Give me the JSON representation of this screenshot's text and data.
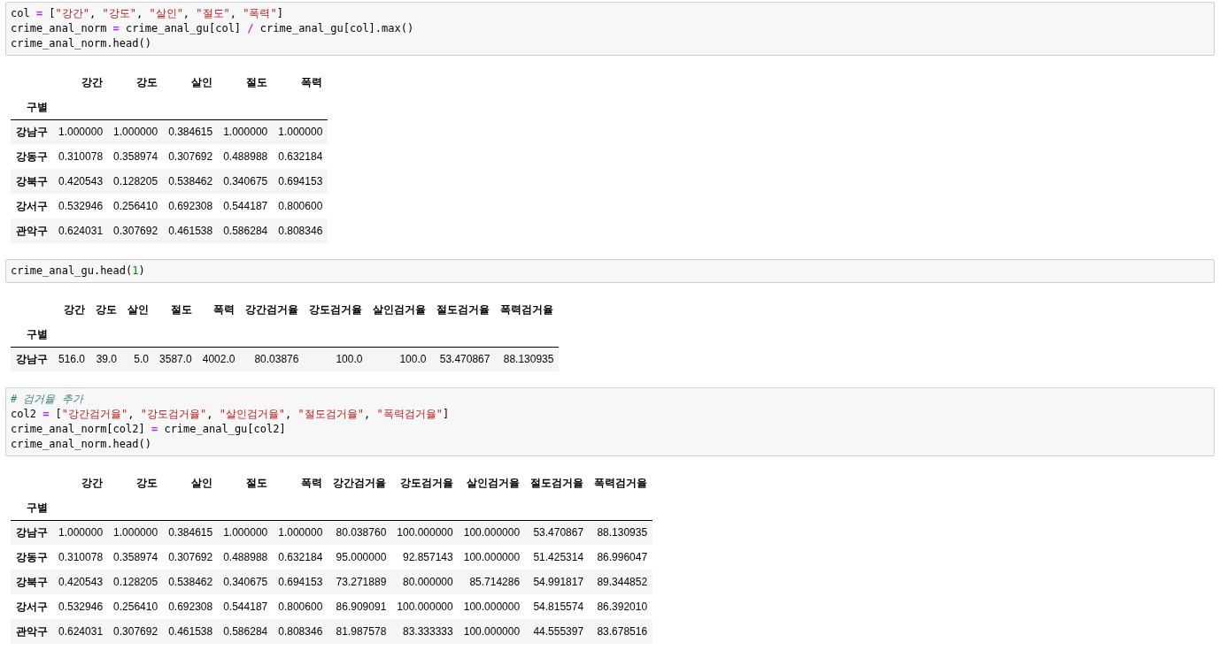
{
  "cells": [
    {
      "kind": "code",
      "lines": [
        [
          {
            "t": "col ",
            "kind": "plain"
          },
          {
            "t": "=",
            "kind": "op"
          },
          {
            "t": " [",
            "kind": "plain"
          },
          {
            "t": "\"강간\"",
            "kind": "string"
          },
          {
            "t": ", ",
            "kind": "plain"
          },
          {
            "t": "\"강도\"",
            "kind": "string"
          },
          {
            "t": ", ",
            "kind": "plain"
          },
          {
            "t": "\"살인\"",
            "kind": "string"
          },
          {
            "t": ", ",
            "kind": "plain"
          },
          {
            "t": "\"절도\"",
            "kind": "string"
          },
          {
            "t": ", ",
            "kind": "plain"
          },
          {
            "t": "\"폭력\"",
            "kind": "string"
          },
          {
            "t": "]",
            "kind": "plain"
          }
        ],
        [
          {
            "t": "crime_anal_norm ",
            "kind": "plain"
          },
          {
            "t": "=",
            "kind": "op"
          },
          {
            "t": " crime_anal_gu[col] ",
            "kind": "plain"
          },
          {
            "t": "/",
            "kind": "op"
          },
          {
            "t": " crime_anal_gu[col].max()",
            "kind": "plain"
          }
        ],
        [
          {
            "t": "crime_anal_norm.head()",
            "kind": "plain"
          }
        ]
      ]
    },
    {
      "kind": "table",
      "index_name": "구별",
      "columns": [
        "강간",
        "강도",
        "살인",
        "절도",
        "폭력"
      ],
      "rows": [
        {
          "index": "강남구",
          "values": [
            "1.000000",
            "1.000000",
            "0.384615",
            "1.000000",
            "1.000000"
          ]
        },
        {
          "index": "강동구",
          "values": [
            "0.310078",
            "0.358974",
            "0.307692",
            "0.488988",
            "0.632184"
          ]
        },
        {
          "index": "강북구",
          "values": [
            "0.420543",
            "0.128205",
            "0.538462",
            "0.340675",
            "0.694153"
          ]
        },
        {
          "index": "강서구",
          "values": [
            "0.532946",
            "0.256410",
            "0.692308",
            "0.544187",
            "0.800600"
          ]
        },
        {
          "index": "관악구",
          "values": [
            "0.624031",
            "0.307692",
            "0.461538",
            "0.586284",
            "0.808346"
          ]
        }
      ]
    },
    {
      "kind": "code",
      "lines": [
        [
          {
            "t": "crime_anal_gu.head(",
            "kind": "plain"
          },
          {
            "t": "1",
            "kind": "number"
          },
          {
            "t": ")",
            "kind": "plain"
          }
        ]
      ]
    },
    {
      "kind": "table",
      "index_name": "구별",
      "columns": [
        "강간",
        "강도",
        "살인",
        "절도",
        "폭력",
        "강간검거율",
        "강도검거율",
        "살인검거율",
        "절도검거율",
        "폭력검거율"
      ],
      "rows": [
        {
          "index": "강남구",
          "values": [
            "516.0",
            "39.0",
            "5.0",
            "3587.0",
            "4002.0",
            "80.03876",
            "100.0",
            "100.0",
            "53.470867",
            "88.130935"
          ]
        }
      ]
    },
    {
      "kind": "code",
      "lines": [
        [
          {
            "t": "# 검거율 추가",
            "kind": "comment"
          }
        ],
        [
          {
            "t": "col2 ",
            "kind": "plain"
          },
          {
            "t": "=",
            "kind": "op"
          },
          {
            "t": " [",
            "kind": "plain"
          },
          {
            "t": "\"강간검거율\"",
            "kind": "string"
          },
          {
            "t": ", ",
            "kind": "plain"
          },
          {
            "t": "\"강도검거율\"",
            "kind": "string"
          },
          {
            "t": ", ",
            "kind": "plain"
          },
          {
            "t": "\"살인검거율\"",
            "kind": "string"
          },
          {
            "t": ", ",
            "kind": "plain"
          },
          {
            "t": "\"절도검거율\"",
            "kind": "string"
          },
          {
            "t": ", ",
            "kind": "plain"
          },
          {
            "t": "\"폭력검거율\"",
            "kind": "string"
          },
          {
            "t": "]",
            "kind": "plain"
          }
        ],
        [
          {
            "t": "crime_anal_norm[col2] ",
            "kind": "plain"
          },
          {
            "t": "=",
            "kind": "op"
          },
          {
            "t": " crime_anal_gu[col2]",
            "kind": "plain"
          }
        ],
        [
          {
            "t": "crime_anal_norm.head()",
            "kind": "plain"
          }
        ]
      ]
    },
    {
      "kind": "table",
      "index_name": "구별",
      "columns": [
        "강간",
        "강도",
        "살인",
        "절도",
        "폭력",
        "강간검거율",
        "강도검거율",
        "살인검거율",
        "절도검거율",
        "폭력검거율"
      ],
      "rows": [
        {
          "index": "강남구",
          "values": [
            "1.000000",
            "1.000000",
            "0.384615",
            "1.000000",
            "1.000000",
            "80.038760",
            "100.000000",
            "100.000000",
            "53.470867",
            "88.130935"
          ]
        },
        {
          "index": "강동구",
          "values": [
            "0.310078",
            "0.358974",
            "0.307692",
            "0.488988",
            "0.632184",
            "95.000000",
            "92.857143",
            "100.000000",
            "51.425314",
            "86.996047"
          ]
        },
        {
          "index": "강북구",
          "values": [
            "0.420543",
            "0.128205",
            "0.538462",
            "0.340675",
            "0.694153",
            "73.271889",
            "80.000000",
            "85.714286",
            "54.991817",
            "89.344852"
          ]
        },
        {
          "index": "강서구",
          "values": [
            "0.532946",
            "0.256410",
            "0.692308",
            "0.544187",
            "0.800600",
            "86.909091",
            "100.000000",
            "100.000000",
            "54.815574",
            "86.392010"
          ]
        },
        {
          "index": "관악구",
          "values": [
            "0.624031",
            "0.307692",
            "0.461538",
            "0.586284",
            "0.808346",
            "81.987578",
            "83.333333",
            "100.000000",
            "44.555397",
            "83.678516"
          ]
        }
      ]
    }
  ]
}
